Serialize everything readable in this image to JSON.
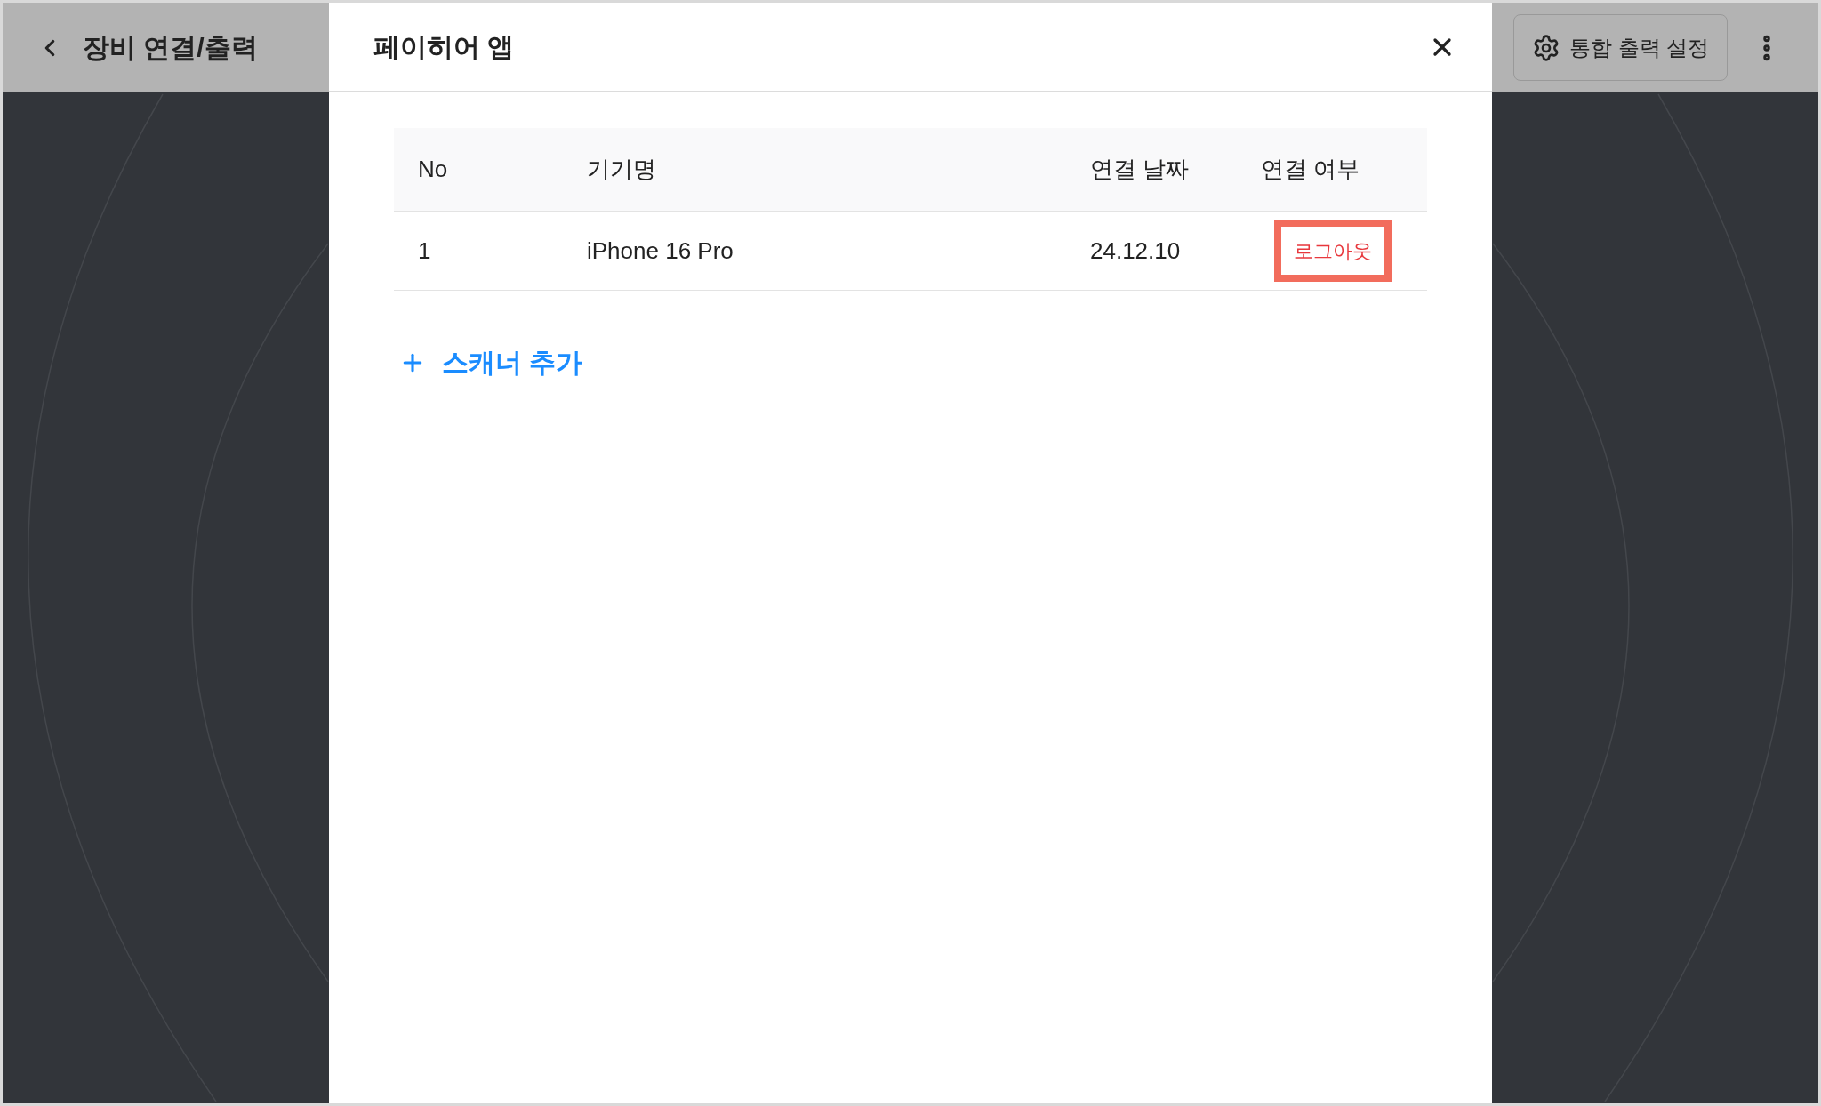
{
  "page": {
    "title": "장비 연결/출력",
    "settings_button": "통합 출력 설정"
  },
  "dialog": {
    "title": "페이히어 앱",
    "table": {
      "columns": [
        "No",
        "기기명",
        "연결 날짜",
        "연결 여부"
      ],
      "rows": [
        {
          "no": "1",
          "device": "iPhone 16 Pro",
          "date": "24.12.10",
          "action": "로그아웃",
          "highlighted": true
        }
      ]
    },
    "add_link": "스캐너 추가"
  }
}
